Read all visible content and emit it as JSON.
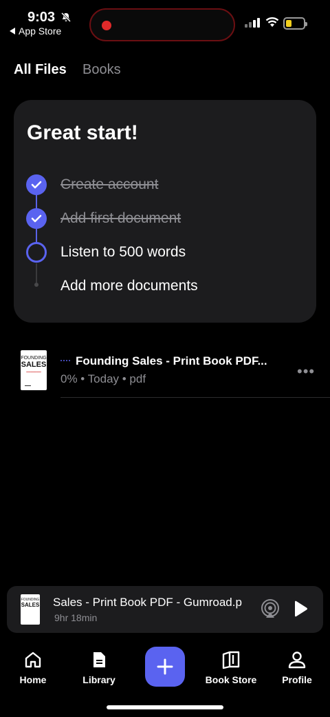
{
  "status_bar": {
    "time": "9:03",
    "back_label": "App Store",
    "battery_color": "#f2cf1c",
    "recording_color": "#e02a2a"
  },
  "tabs": [
    {
      "label": "All Files",
      "active": true
    },
    {
      "label": "Books",
      "active": false
    }
  ],
  "checklist": {
    "title": "Great start!",
    "steps": [
      {
        "label": "Create account",
        "done": true
      },
      {
        "label": "Add first document",
        "done": true
      },
      {
        "label": "Listen to 500 words",
        "done": false
      },
      {
        "label": "Add more documents",
        "done": false
      }
    ]
  },
  "files": [
    {
      "title": "Founding Sales - Print Book PDF...",
      "meta": "0% • Today • pdf",
      "cover": {
        "line1": "FOUNDING",
        "line2": "SALES"
      },
      "progress_percent": 0
    }
  ],
  "player": {
    "title": "Sales - Print Book PDF - Gumroad.p",
    "duration": "9hr 18min",
    "cover": {
      "line1": "FOUNDING",
      "line2": "SALES"
    }
  },
  "tab_bar": {
    "home": "Home",
    "library": "Library",
    "book_store": "Book Store",
    "profile": "Profile"
  },
  "accent_color": "#5a63f0",
  "icons": [
    "bell-slash-icon",
    "back-arrow-icon",
    "signal-icon",
    "wifi-icon",
    "battery-icon",
    "check-icon",
    "more-icon",
    "airplay-icon",
    "play-icon",
    "home-icon",
    "library-icon",
    "plus-icon",
    "book-store-icon",
    "profile-icon"
  ]
}
